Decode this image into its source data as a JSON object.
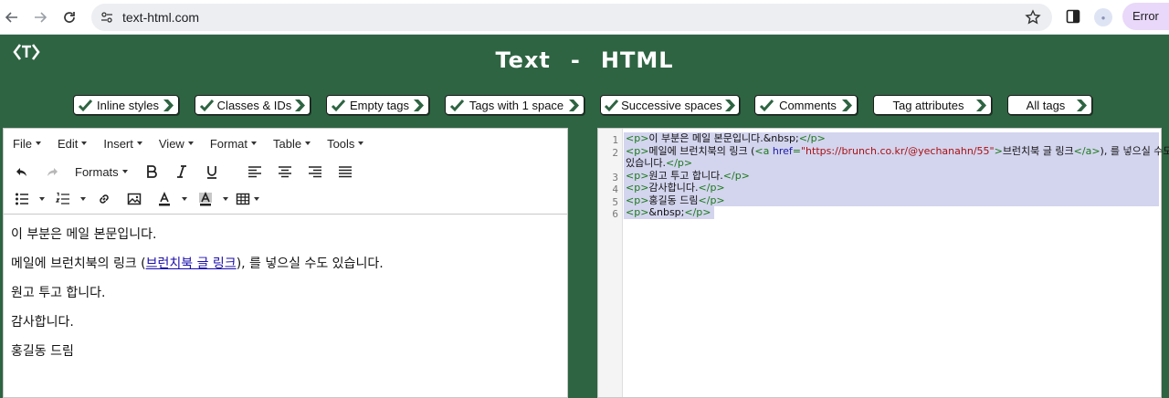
{
  "browser": {
    "url": "text-html.com",
    "error_label": "Error"
  },
  "app": {
    "title_left": "Text",
    "title_sep": "-",
    "title_right": "HTML"
  },
  "options": [
    {
      "label": "Inline styles",
      "checked": true
    },
    {
      "label": "Classes & IDs",
      "checked": true
    },
    {
      "label": "Empty tags",
      "checked": true
    },
    {
      "label": "Tags with 1 space",
      "checked": true
    },
    {
      "label": "Successive spaces",
      "checked": true
    },
    {
      "label": "Comments",
      "checked": true
    },
    {
      "label": "Tag attributes",
      "checked": false
    },
    {
      "label": "All tags",
      "checked": false
    }
  ],
  "editor": {
    "menu": [
      "File",
      "Edit",
      "Insert",
      "View",
      "Format",
      "Table",
      "Tools"
    ],
    "formats_label": "Formats",
    "content": {
      "p1": "이 부분은 메일 본문입니다.",
      "p2_before": "메일에 브런치북의 링크 (",
      "p2_link": "브런치북 글 링크",
      "p2_after": "), 를 넣으실 수도 있습니다.",
      "p3": "원고 투고 합니다.",
      "p4": "감사합니다.",
      "p5": "홍길동 드림"
    }
  },
  "code": {
    "line_numbers": [
      "1",
      "2",
      "3",
      "4",
      "5",
      "6"
    ],
    "l1_text": "이 부분은 메일 본문입니다.&nbsp;",
    "l2_text": "메일에 브런치북의 링크 (",
    "l2_href_attr": "href",
    "l2_href_val": "\"https://brunch.co.kr/@yechanahn/55\"",
    "l2_link_text": "브런치북 글 링크",
    "l2_after": "), 를 넣으실 수도",
    "l2_wrap": "있습니다.",
    "l3_text": "원고 투고 합니다.",
    "l4_text": "감사합니다.",
    "l5_text": "홍길동 드림",
    "l6_text": "&nbsp;"
  },
  "colors": {
    "page_bg": "#2e6442",
    "selection": "#d3d4ee",
    "tag": "#1a7a1a",
    "attr": "#1a1aa8",
    "string": "#a11111",
    "check": "#2e6442"
  }
}
